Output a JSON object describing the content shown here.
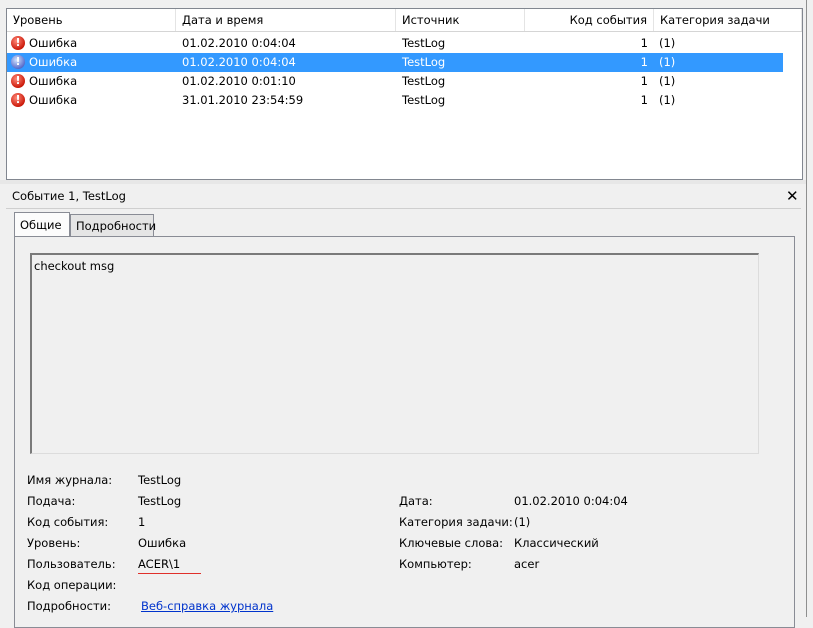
{
  "list": {
    "columns": [
      "Уровень",
      "Дата и время",
      "Источник",
      "Код события",
      "Категория задачи"
    ],
    "rows": [
      {
        "level": "Ошибка",
        "datetime": "01.02.2010 0:04:04",
        "source": "TestLog",
        "code": "1",
        "category": "(1)",
        "selected": false
      },
      {
        "level": "Ошибка",
        "datetime": "01.02.2010 0:04:04",
        "source": "TestLog",
        "code": "1",
        "category": "(1)",
        "selected": true
      },
      {
        "level": "Ошибка",
        "datetime": "01.02.2010 0:01:10",
        "source": "TestLog",
        "code": "1",
        "category": "(1)",
        "selected": false
      },
      {
        "level": "Ошибка",
        "datetime": "31.01.2010 23:54:59",
        "source": "TestLog",
        "code": "1",
        "category": "(1)",
        "selected": false
      }
    ],
    "icon": "error-icon",
    "selected_color": "#3399ff"
  },
  "detail": {
    "title": "Событие 1, TestLog",
    "close_glyph": "✕",
    "tabs": [
      "Общие",
      "Подробности"
    ],
    "message": "checkout msg",
    "props": {
      "log_name_label": "Имя журнала:",
      "log_name_value": "TestLog",
      "source_label": "Подача:",
      "source_value": "TestLog",
      "date_label": "Дата:",
      "date_value": "01.02.2010 0:04:04",
      "code_label": "Код события:",
      "code_value": "1",
      "category_label": "Категория задачи:",
      "category_value": "(1)",
      "level_label": "Уровень:",
      "level_value": "Ошибка",
      "keywords_label": "Ключевые слова:",
      "keywords_value": "Классический",
      "user_label": "Пользователь:",
      "user_value": "ACER\\1",
      "computer_label": "Компьютер:",
      "computer_value": "acer",
      "opcode_label": "Код операции:",
      "details_label": "Подробности:",
      "details_link": "Веб-справка журнала"
    }
  }
}
